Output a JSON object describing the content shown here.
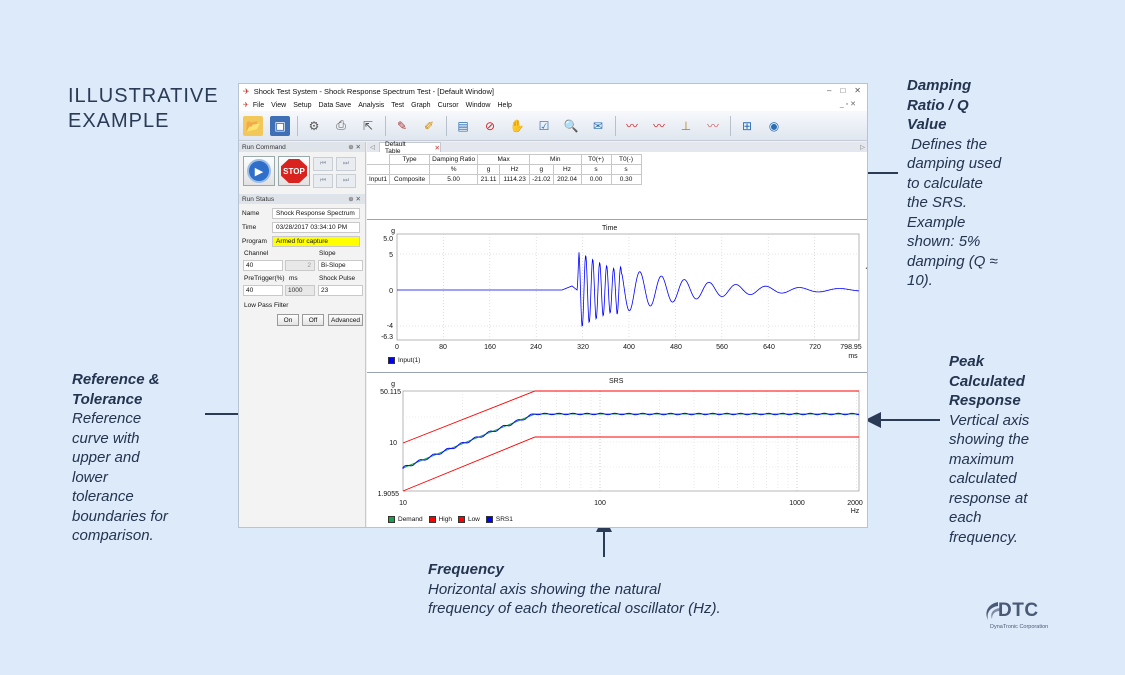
{
  "slide": {
    "heading_line1": "ILLUSTRATIVE",
    "heading_line2": "EXAMPLE"
  },
  "annotations": {
    "damping": {
      "title_lines": [
        "Damping",
        "Ratio / Q",
        "Value"
      ],
      "desc_lines": [
        " Defines the",
        "damping used",
        "to calculate",
        "the SRS.",
        "Example",
        "shown: 5%",
        "damping (Q ≈",
        "10)."
      ]
    },
    "reference": {
      "title_lines": [
        "Reference &",
        "Tolerance"
      ],
      "desc_lines": [
        "Reference",
        "curve with",
        "upper and",
        "lower",
        "tolerance",
        "boundaries for",
        "comparison."
      ]
    },
    "peak": {
      "title_lines": [
        "Peak",
        "Calculated",
        "Response"
      ],
      "desc_lines": [
        "Vertical axis",
        "showing the",
        "maximum",
        "calculated",
        "response at",
        "each",
        "frequency."
      ]
    },
    "frequency": {
      "title_lines": [
        "Frequency"
      ],
      "desc_lines": [
        "Horizontal axis showing the natural",
        "frequency of each theoretical oscillator (Hz)."
      ]
    }
  },
  "logo": {
    "word": "DTC",
    "sub": "DynaTronic Corporation"
  },
  "app": {
    "title": "Shock Test System - Shock Response Spectrum Test - [Default Window]",
    "menu": [
      "File",
      "View",
      "Setup",
      "Data Save",
      "Analysis",
      "Test",
      "Graph",
      "Cursor",
      "Window",
      "Help"
    ],
    "run_command": {
      "header": "Run Command",
      "stop_label": "STOP"
    },
    "run_status": {
      "header": "Run Status",
      "name_label": "Name",
      "name_value": "Shock Response Spectrum",
      "time_label": "Time",
      "time_value": "03/28/2017 03:34:10 PM",
      "program_label": "Program",
      "program_value": "Armed for capture",
      "channel_label": "Channel",
      "channel_value": "40",
      "channel_num": "2",
      "slope_label": "Slope",
      "slope_value": "Bi-Slope",
      "pretrigger_label": "PreTrigger(%)",
      "pretrigger_unit": "ms",
      "pretrigger_value": "40",
      "pretrigger_ms": "1000",
      "shock_pulse_label": "Shock Pulse",
      "shock_pulse_value": "23",
      "lpf_label": "Low Pass Filter",
      "on_label": "On",
      "off_label": "Off",
      "advanced_label": "Advanced"
    },
    "tab_label": "Default Table",
    "table": {
      "headers": [
        "Type",
        "Damping Ratio",
        "Max",
        "Min",
        "T0(+)",
        "T0(-)"
      ],
      "units": [
        "%",
        "g",
        "Hz",
        "g",
        "Hz",
        "s",
        "s"
      ],
      "row": [
        "Input1",
        "Composite",
        "5.00",
        "21.11",
        "1114.23",
        "-21.02",
        "202.04",
        "0.00",
        "0.30"
      ]
    },
    "time_plot": {
      "title": "Time",
      "y_unit": "g",
      "y_ticks": [
        "5.0",
        "5",
        "0",
        "-4",
        "-6.3"
      ],
      "x_ticks": [
        "0",
        "80",
        "160",
        "240",
        "320",
        "400",
        "480",
        "560",
        "640",
        "720",
        "798.95"
      ],
      "x_unit": "ms",
      "legend": "Input(1)"
    },
    "srs_plot": {
      "title": "SRS",
      "y_unit": "g",
      "y_ticks": [
        "50.115",
        "10",
        "1.9055"
      ],
      "x_ticks": [
        "10",
        "100",
        "1000",
        "2000"
      ],
      "x_unit": "Hz",
      "legend": [
        "Demand",
        "High",
        "Low",
        "SRS1"
      ]
    }
  },
  "colors": {
    "background": "#ddeafa",
    "annotation_text": "#25344f",
    "arrow": "#2b3a55",
    "signal": "#0000ff",
    "tolerance": "#ff0000",
    "demand": "#16a34a"
  }
}
